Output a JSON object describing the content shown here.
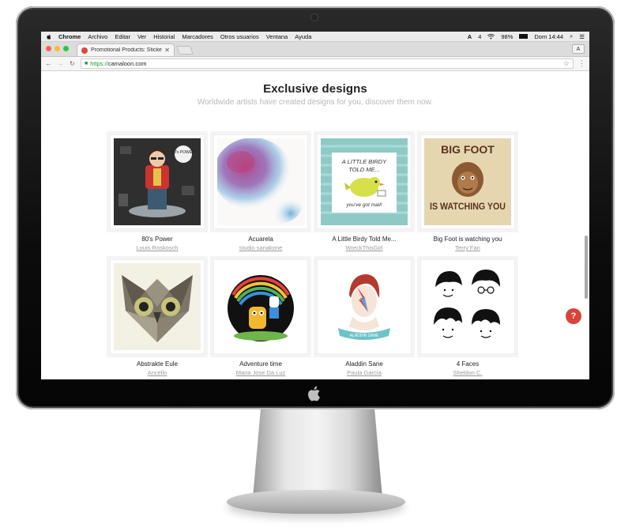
{
  "menubar": {
    "items": [
      "Chrome",
      "Archivo",
      "Editar",
      "Ver",
      "Historial",
      "Marcadores",
      "Otros usuarios",
      "Ventana",
      "Ayuda"
    ],
    "right": {
      "adobe_count": "4",
      "battery": "98%",
      "clock": "Dom 14:44"
    }
  },
  "browser": {
    "tab_title": "Promotional Products: Sticke",
    "profile_label": "A",
    "url_scheme": "https://",
    "url_host": "camaloon.com"
  },
  "page": {
    "headline": "Exclusive designs",
    "subline": "Worldwide artists have created designs for you, discover them now.",
    "designs": [
      {
        "title": "80's Power",
        "author": "Louis Roskosch"
      },
      {
        "title": "Acuarela",
        "author": "studio sanakone"
      },
      {
        "title": "A Little Birdy Told Me...",
        "author": "WreckThisGirl"
      },
      {
        "title": "Big Foot is watching you",
        "author": "Terry Fan"
      },
      {
        "title": "Abstrakte Eule",
        "author": "Ancello"
      },
      {
        "title": "Adventure time",
        "author": "Maria Jose Da Luz"
      },
      {
        "title": "Aladdin Sane",
        "author": "Paula García"
      },
      {
        "title": "4 Faces",
        "author": "Sheldon C."
      }
    ],
    "artwork_text": {
      "power_badge": "80's POWER",
      "birdy_line1": "A LITTLE BIRDY",
      "birdy_line2": "TOLD ME...",
      "birdy_line3": "you've got mail!",
      "bigfoot_top": "BIG FOOT",
      "bigfoot_bottom": "IS WATCHING YOU",
      "aladdin_ribbon": "ALADDIN SANE"
    },
    "help_label": "?"
  },
  "colors": {
    "accent_red": "#d9443a",
    "link_gray": "#9a9a9a",
    "secure_green": "#1a9a3a"
  }
}
